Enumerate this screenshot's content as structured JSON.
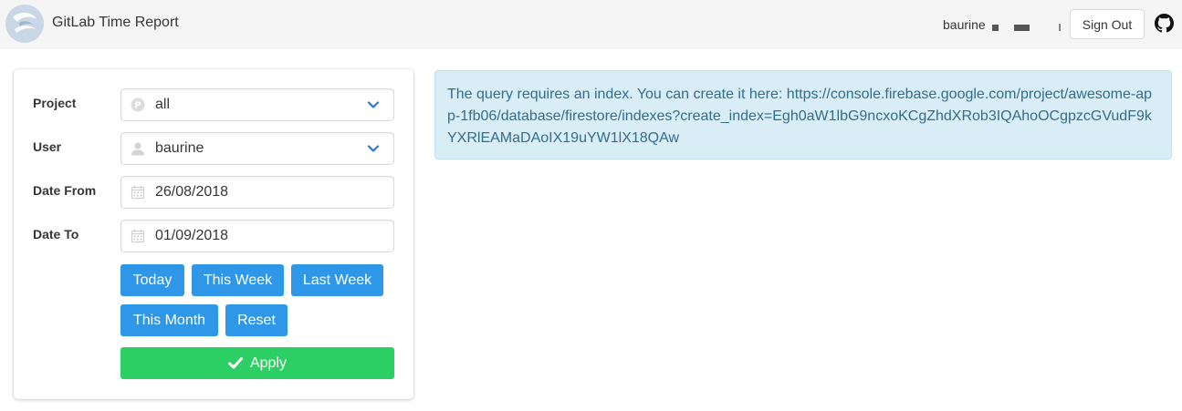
{
  "header": {
    "brand": "GitLab Time Report",
    "user_name": "baurine",
    "sign_out_label": "Sign Out",
    "github_icon": "github-icon",
    "logo_icon": "app-logo"
  },
  "form": {
    "project": {
      "label": "Project",
      "value": "all",
      "icon": "project-p-icon"
    },
    "user": {
      "label": "User",
      "value": "baurine",
      "icon": "user-icon"
    },
    "date_from": {
      "label": "Date From",
      "value": "26/08/2018",
      "icon": "calendar-icon"
    },
    "date_to": {
      "label": "Date To",
      "value": "01/09/2018",
      "icon": "calendar-icon"
    },
    "quick_buttons": {
      "today": "Today",
      "this_week": "This Week",
      "last_week": "Last Week",
      "this_month": "This Month",
      "reset": "Reset"
    },
    "apply_label": "Apply"
  },
  "notification": {
    "message": "The query requires an index. You can create it here: https://console.firebase.google.com/project/awesome-app-1fb06/database/firestore/indexes?create_index=Egh0aW1lbG9ncxoKCgZhdXRob3IQAhoOCgpzcGVudF9kYXRlEAMaDAoIX19uYW1lX18QAw"
  },
  "colors": {
    "primary_button": "#2e97e8",
    "apply_button": "#2ccf63",
    "notice_background": "#d9edf6",
    "notice_text": "#316e8d",
    "navbar_background": "#f5f5f5"
  }
}
